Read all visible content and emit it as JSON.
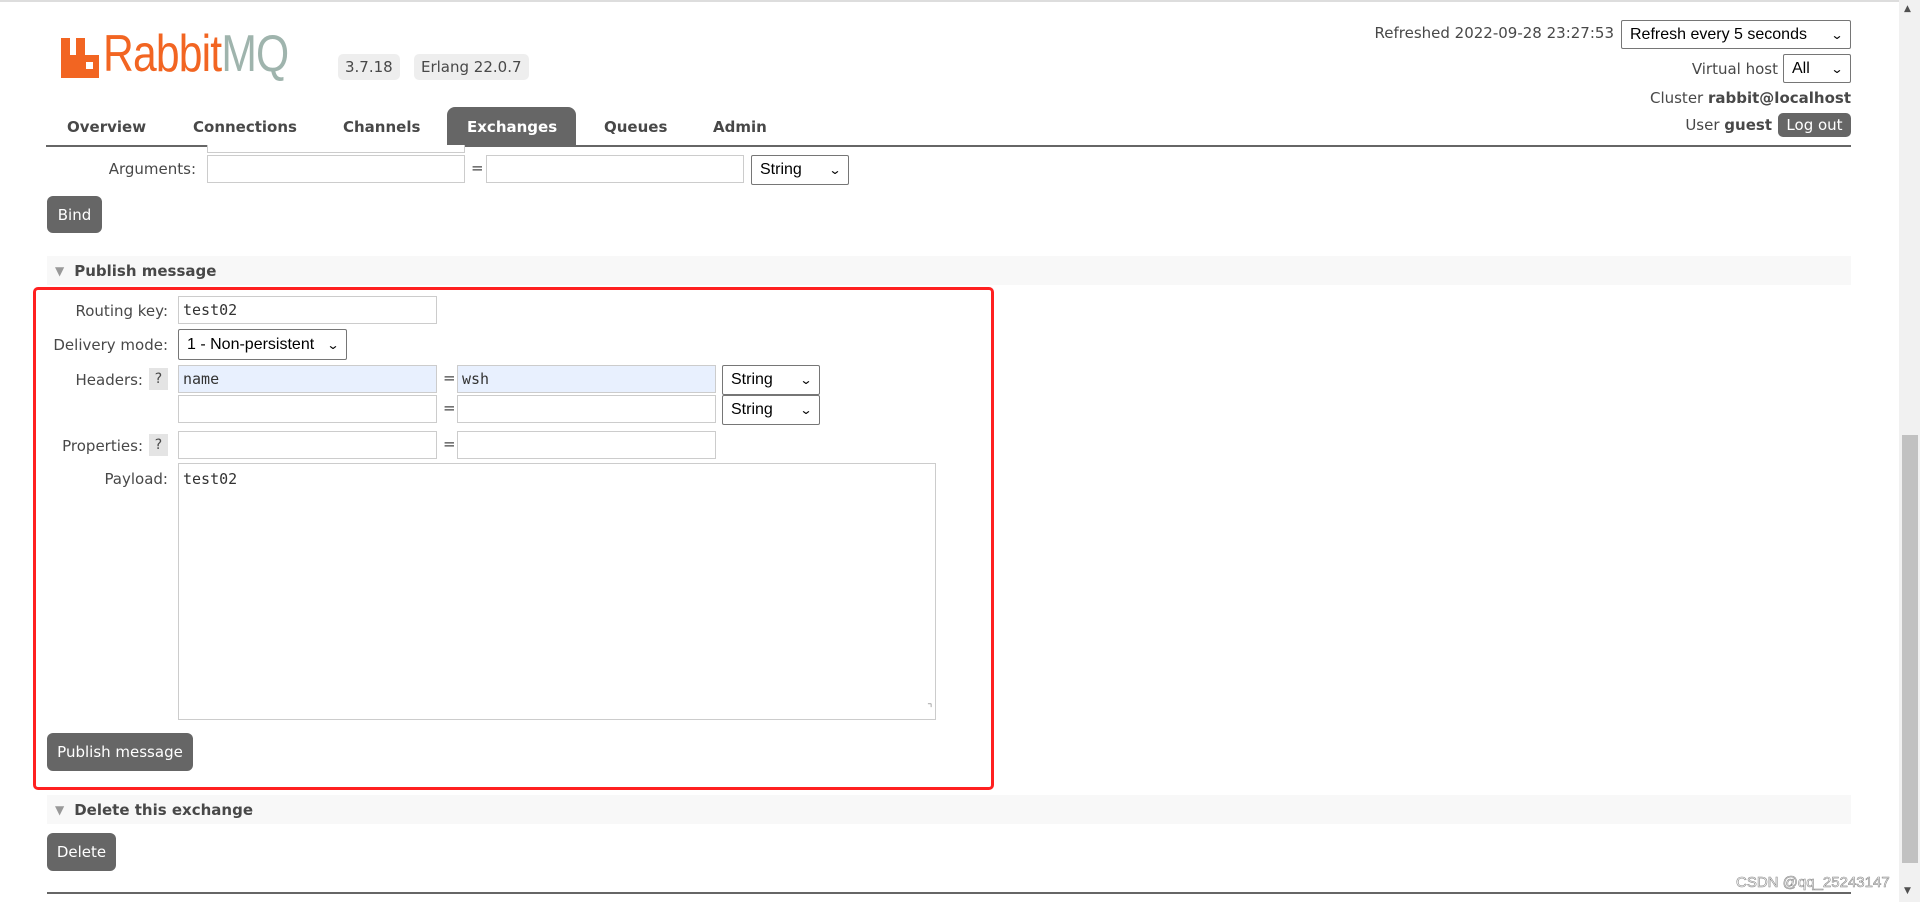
{
  "brand": {
    "logo_text_1": "Rabbit",
    "logo_text_2": "MQ",
    "version": "3.7.18",
    "erlang": "Erlang 22.0.7",
    "accent": "#f26522"
  },
  "nav": {
    "tabs": [
      {
        "label": "Overview"
      },
      {
        "label": "Connections"
      },
      {
        "label": "Channels"
      },
      {
        "label": "Exchanges",
        "active": true
      },
      {
        "label": "Queues"
      },
      {
        "label": "Admin"
      }
    ]
  },
  "header": {
    "refreshed": "Refreshed 2022-09-28 23:27:53",
    "refresh_select": "Refresh every 5 seconds",
    "vhost_label": "Virtual host",
    "vhost_select": "All",
    "cluster_label": "Cluster",
    "cluster_name": "rabbit@localhost",
    "user_label": "User",
    "user_name": "guest",
    "logout": "Log out"
  },
  "bind": {
    "arguments_label": "Arguments:",
    "eq": "=",
    "type": "String",
    "bind_button": "Bind"
  },
  "publish": {
    "section_title": "Publish message",
    "routing_key_label": "Routing key:",
    "routing_key": "test02",
    "delivery_mode_label": "Delivery mode:",
    "delivery_mode": "1 - Non-persistent",
    "headers_label": "Headers:",
    "help": "?",
    "eq": "=",
    "headers": [
      {
        "key": "name",
        "value": "wsh",
        "type": "String"
      },
      {
        "key": "",
        "value": "",
        "type": "String"
      }
    ],
    "properties_label": "Properties:",
    "payload_label": "Payload:",
    "payload": "test02",
    "publish_button": "Publish message",
    "highlight_color": "#ff2020"
  },
  "delete": {
    "section_title": "Delete this exchange",
    "delete_button": "Delete"
  },
  "watermark": "CSDN @qq_25243147"
}
